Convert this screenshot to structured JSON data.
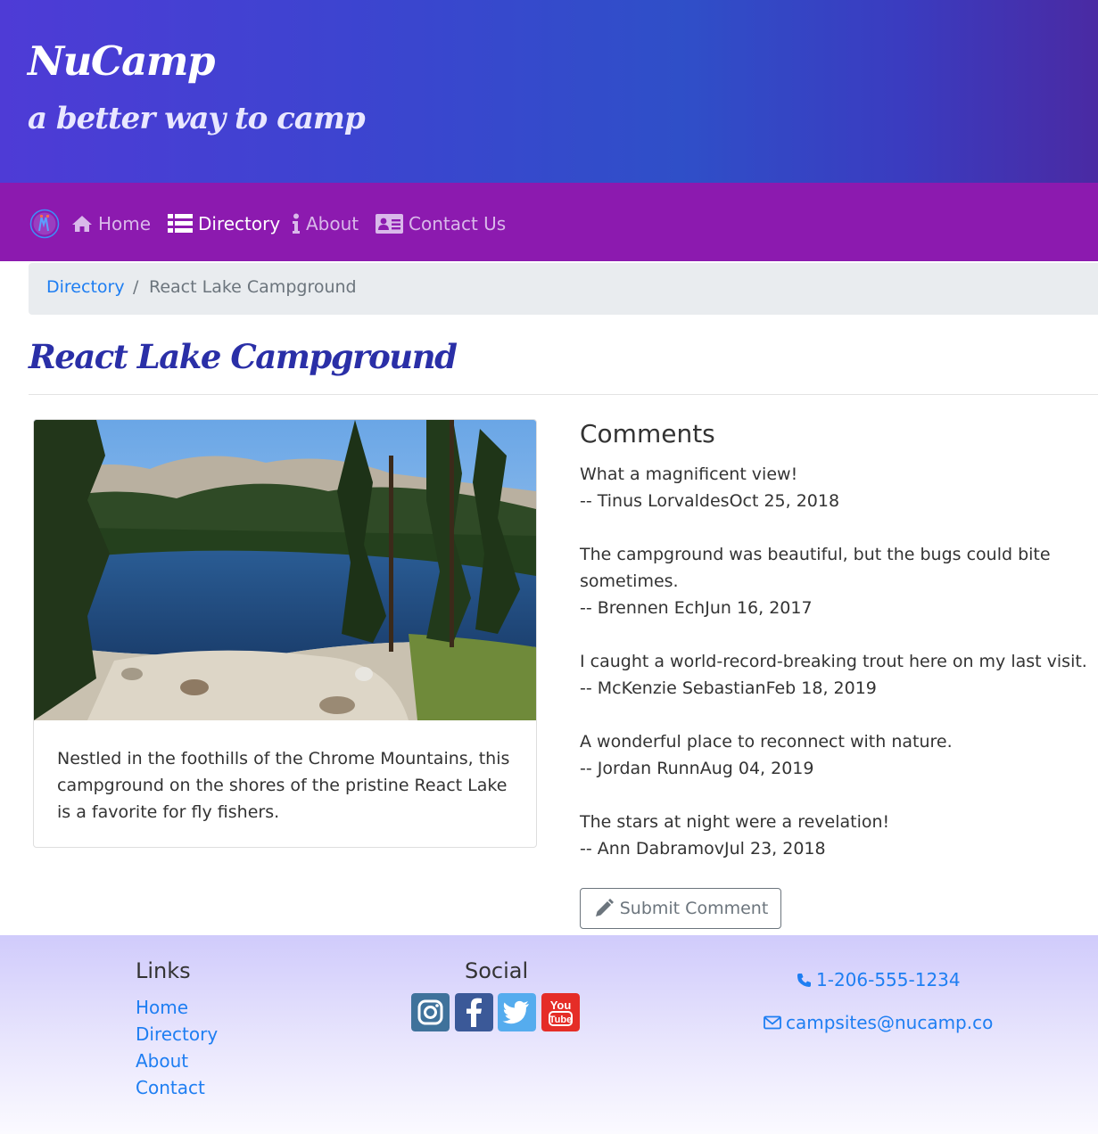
{
  "header": {
    "brand": "NuCamp",
    "tagline": "a better way to camp"
  },
  "nav": {
    "home": "Home",
    "directory": "Directory",
    "about": "About",
    "contact": "Contact Us"
  },
  "breadcrumb": {
    "parent": "Directory",
    "separator": "/",
    "current": "React Lake Campground"
  },
  "campsite": {
    "title": "React Lake Campground",
    "description": "Nestled in the foothills of the Chrome Mountains, this campground on the shores of the pristine React Lake is a favorite for fly fishers."
  },
  "comments": {
    "heading": "Comments",
    "items": [
      {
        "text": "What a magnificent view!",
        "attribution": "-- Tinus LorvaldesOct 25, 2018"
      },
      {
        "text": "The campground was beautiful, but the bugs could bite sometimes.",
        "attribution": "-- Brennen EchJun 16, 2017"
      },
      {
        "text": "I caught a world-record-breaking trout here on my last visit.",
        "attribution": "-- McKenzie SebastianFeb 18, 2019"
      },
      {
        "text": "A wonderful place to reconnect with nature.",
        "attribution": "-- Jordan RunnAug 04, 2019"
      },
      {
        "text": "The stars at night were a revelation!",
        "attribution": "-- Ann DabramovJul 23, 2018"
      }
    ],
    "submit_label": "Submit Comment"
  },
  "footer": {
    "links_heading": "Links",
    "links": [
      "Home",
      "Directory",
      "About",
      "Contact"
    ],
    "social_heading": "Social",
    "social": [
      {
        "icon": "instagram-icon",
        "color": "#3f729b"
      },
      {
        "icon": "facebook-icon",
        "color": "#3b5998"
      },
      {
        "icon": "twitter-icon",
        "color": "#55acee"
      },
      {
        "icon": "youtube-icon",
        "color": "#e52d27"
      }
    ],
    "phone": "1-206-555-1234",
    "email": "campsites@nucamp.co"
  },
  "colors": {
    "jumbotron": "#3b45cf",
    "navbar": "#8c1aaf",
    "title": "#2a2fa7",
    "link": "#1e7ef2"
  }
}
